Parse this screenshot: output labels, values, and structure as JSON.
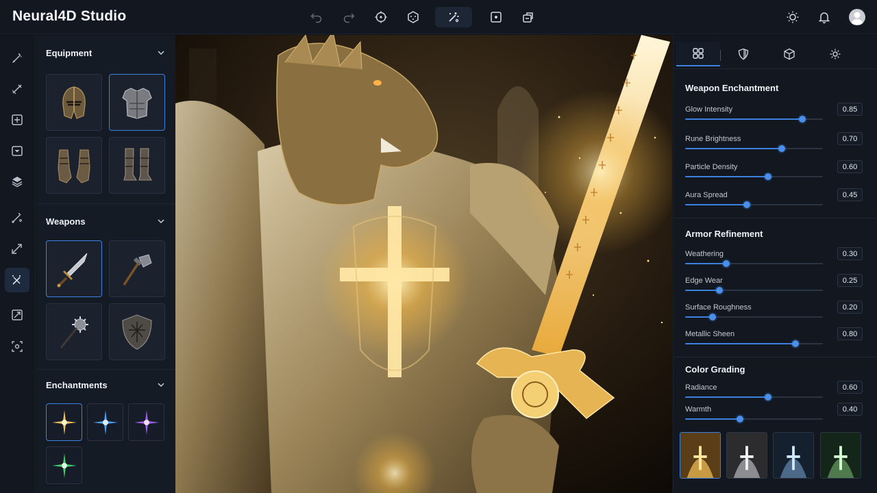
{
  "app": {
    "title": "Neural4D Studio"
  },
  "toolbar": {
    "center_icons": [
      "undo-icon",
      "redo-icon",
      "target-icon",
      "dice-icon",
      "magic-wand-icon",
      "frame-icon",
      "export-icon"
    ],
    "active": "magic-wand-icon",
    "right_icons": [
      "sun-icon",
      "bell-icon",
      "user-avatar"
    ]
  },
  "rail": {
    "icons": [
      "brush-icon",
      "pen-icon",
      "crop-icon",
      "bake-icon",
      "layers-icon",
      "path-icon",
      "transform-icon",
      "magic-wand-icon",
      "resize-icon",
      "select-icon"
    ],
    "active": "magic-wand-icon"
  },
  "assets": {
    "equipment": {
      "title": "Equipment",
      "items": [
        "helmet",
        "chest-armor",
        "gauntlets",
        "greaves"
      ],
      "selected": "chest-armor"
    },
    "weapons": {
      "title": "Weapons",
      "items": [
        "sword",
        "war-hammer",
        "mace",
        "shield"
      ],
      "selected": "sword"
    },
    "enchantments": {
      "title": "Enchantments",
      "items": [
        "gold-star",
        "blue-star",
        "purple-star",
        "green-star"
      ],
      "selected": "gold-star"
    }
  },
  "tabs": {
    "icons": [
      "grid-icon",
      "shield-icon",
      "cube-icon",
      "light-icon"
    ],
    "active": "grid-icon"
  },
  "weapon_enchantment": {
    "title": "Weapon Enchantment",
    "sliders": [
      {
        "label": "Glow Intensity",
        "value": "0.85",
        "level": 0.85
      },
      {
        "label": "Rune Brightness",
        "value": "0.70",
        "level": 0.7
      },
      {
        "label": "Particle Density",
        "value": "0.60",
        "level": 0.6
      },
      {
        "label": "Aura Spread",
        "value": "0.45",
        "level": 0.45
      }
    ]
  },
  "armor_refinement": {
    "title": "Armor Refinement",
    "sliders": [
      {
        "label": "Weathering",
        "value": "0.30",
        "level": 0.3
      },
      {
        "label": "Edge Wear",
        "value": "0.25",
        "level": 0.25
      },
      {
        "label": "Surface Roughness",
        "value": "0.20",
        "level": 0.2
      },
      {
        "label": "Metallic Sheen",
        "value": "0.80",
        "level": 0.8
      }
    ]
  },
  "color_grading": {
    "title": "Color Grading",
    "sliders": [
      {
        "label": "Radiance",
        "value": "0.60",
        "level": 0.6
      },
      {
        "label": "Warmth",
        "value": "0.40",
        "level": 0.4
      }
    ],
    "presets": [
      "gold",
      "silver",
      "blue",
      "green"
    ],
    "selected_preset": "gold"
  },
  "colors": {
    "accent": "#3b82e0",
    "panel": "#151b25",
    "background": "#0f131a",
    "gold": "#e8b84a"
  }
}
